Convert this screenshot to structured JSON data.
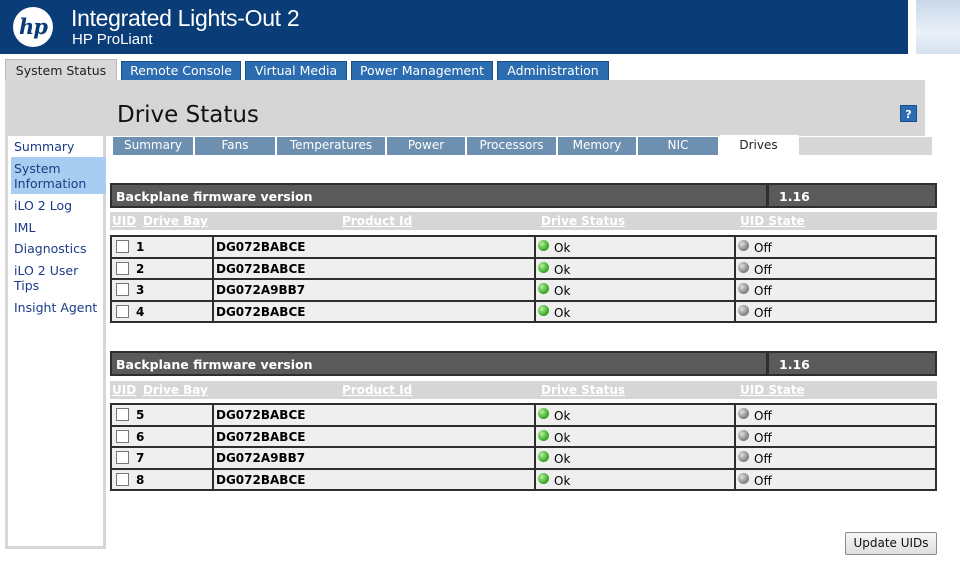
{
  "header": {
    "logo_text": "hp",
    "title": "Integrated Lights-Out 2",
    "subtitle": "HP ProLiant"
  },
  "top_tabs": [
    {
      "label": "System Status",
      "active": true
    },
    {
      "label": "Remote Console",
      "active": false
    },
    {
      "label": "Virtual Media",
      "active": false
    },
    {
      "label": "Power Management",
      "active": false
    },
    {
      "label": "Administration",
      "active": false
    }
  ],
  "page": {
    "title": "Drive Status",
    "help_label": "?"
  },
  "sidebar": {
    "items": [
      {
        "label": "Summary",
        "active": false
      },
      {
        "label": "System Information",
        "active": true
      },
      {
        "label": "iLO 2 Log",
        "active": false
      },
      {
        "label": "IML",
        "active": false
      },
      {
        "label": "Diagnostics",
        "active": false
      },
      {
        "label": "iLO 2 User Tips",
        "active": false
      },
      {
        "label": "Insight Agent",
        "active": false
      }
    ]
  },
  "sub_tabs": [
    {
      "label": "Summary",
      "active": false
    },
    {
      "label": "Fans",
      "active": false
    },
    {
      "label": "Temperatures",
      "active": false
    },
    {
      "label": "Power",
      "active": false
    },
    {
      "label": "Processors",
      "active": false
    },
    {
      "label": "Memory",
      "active": false
    },
    {
      "label": "NIC",
      "active": false
    },
    {
      "label": "Drives",
      "active": true
    }
  ],
  "columns": {
    "uid": "UID",
    "drive_bay": "Drive Bay",
    "product_id": "Product Id",
    "drive_status": "Drive Status",
    "uid_state": "UID State"
  },
  "backplanes": [
    {
      "firmware_label": "Backplane firmware version",
      "firmware_version": "1.16",
      "drives": [
        {
          "bay": "1",
          "product_id": "DG072BABCE",
          "status": "Ok",
          "uid_state": "Off"
        },
        {
          "bay": "2",
          "product_id": "DG072BABCE",
          "status": "Ok",
          "uid_state": "Off"
        },
        {
          "bay": "3",
          "product_id": "DG072A9BB7",
          "status": "Ok",
          "uid_state": "Off"
        },
        {
          "bay": "4",
          "product_id": "DG072BABCE",
          "status": "Ok",
          "uid_state": "Off"
        }
      ]
    },
    {
      "firmware_label": "Backplane firmware version",
      "firmware_version": "1.16",
      "drives": [
        {
          "bay": "5",
          "product_id": "DG072BABCE",
          "status": "Ok",
          "uid_state": "Off"
        },
        {
          "bay": "6",
          "product_id": "DG072BABCE",
          "status": "Ok",
          "uid_state": "Off"
        },
        {
          "bay": "7",
          "product_id": "DG072A9BB7",
          "status": "Ok",
          "uid_state": "Off"
        },
        {
          "bay": "8",
          "product_id": "DG072BABCE",
          "status": "Ok",
          "uid_state": "Off"
        }
      ]
    }
  ],
  "actions": {
    "update_uids_label": "Update UIDs"
  },
  "icons": {
    "status_ok": "green-ok-icon",
    "uid_off": "grey-off-icon",
    "help": "help-icon"
  },
  "colors": {
    "header_bg": "#0a3c78",
    "tab_blue": "#2c6cb0",
    "subtab_blue": "#6d8fb0",
    "link_blue": "#1a3b86",
    "status_ok": "#3fae2a",
    "uid_off": "#8a8a8a"
  }
}
